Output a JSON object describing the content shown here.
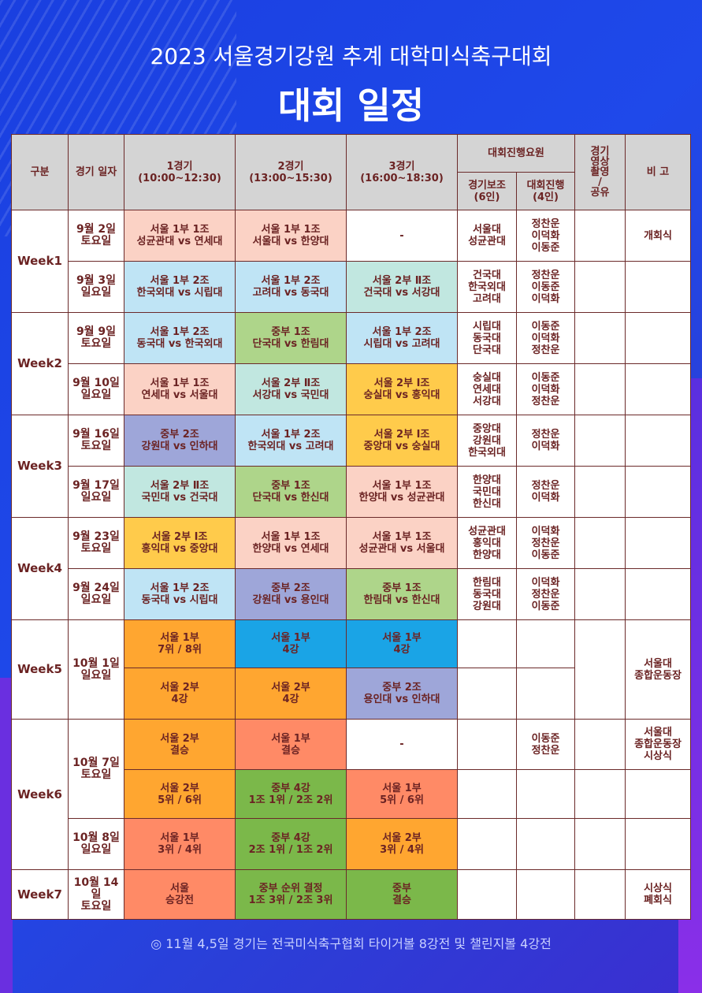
{
  "header": {
    "subtitle": "2023 서울경기강원 추계 대학미식축구대회",
    "title": "대회 일정"
  },
  "columns": {
    "category": "구분",
    "date": "경기 일자",
    "game1": "1경기\n(10:00~12:30)",
    "game2": "2경기\n(13:00~15:30)",
    "game3": "3경기\n(16:00~18:30)",
    "staff": "대회진행요원",
    "assist": "경기보조\n(6인)",
    "progress": "대회진행\n(4인)",
    "video": "경기\n영상\n촬영\n/\n공유",
    "note": "비 고"
  },
  "rows": [
    {
      "week": "Week1",
      "date": "9월 2일\n토요일",
      "g1": "서울 1부 1조\n성균관대 vs 연세대",
      "g2": "서울 1부 1조\n서울대 vs 한양대",
      "g3": "-",
      "assist": "서울대\n성균관대",
      "prog": "정찬운\n이덕화\n이동준",
      "video": "",
      "note": "개회식"
    },
    {
      "week": "",
      "date": "9월 3일\n일요일",
      "g1": "서울 1부 2조\n한국외대 vs 시립대",
      "g2": "서울 1부 2조\n고려대 vs 동국대",
      "g3": "서울 2부 Ⅱ조\n건국대 vs 서강대",
      "assist": "건국대\n한국외대\n고려대",
      "prog": "정찬운\n이동준\n이덕화",
      "video": "",
      "note": ""
    },
    {
      "week": "Week2",
      "date": "9월 9일\n토요일",
      "g1": "서울 1부 2조\n동국대 vs 한국외대",
      "g2": "중부 1조\n단국대 vs 한림대",
      "g3": "서울 1부 2조\n시립대 vs 고려대",
      "assist": "시립대\n동국대\n단국대",
      "prog": "이동준\n이덕화\n정찬운",
      "video": "",
      "note": ""
    },
    {
      "week": "",
      "date": "9월 10일\n일요일",
      "g1": "서울 1부 1조\n연세대 vs 서울대",
      "g2": "서울 2부 Ⅱ조\n서강대 vs 국민대",
      "g3": "서울 2부 Ⅰ조\n숭실대 vs 홍익대",
      "assist": "숭실대\n연세대\n서강대",
      "prog": "이동준\n이덕화\n정찬운",
      "video": "",
      "note": ""
    },
    {
      "week": "Week3",
      "date": "9월 16일\n토요일",
      "g1": "중부 2조\n강원대 vs 인하대",
      "g2": "서울 1부 2조\n한국외대 vs 고려대",
      "g3": "서울 2부 Ⅰ조\n중앙대 vs 숭실대",
      "assist": "중앙대\n강원대\n한국외대",
      "prog": "정찬운\n이덕화",
      "video": "",
      "note": ""
    },
    {
      "week": "",
      "date": "9월 17일\n일요일",
      "g1": "서울 2부 Ⅱ조\n국민대 vs 건국대",
      "g2": "중부 1조\n단국대 vs 한신대",
      "g3": "서울 1부 1조\n한양대 vs 성균관대",
      "assist": "한양대\n국민대\n한신대",
      "prog": "정찬운\n이덕화",
      "video": "",
      "note": ""
    },
    {
      "week": "Week4",
      "date": "9월 23일\n토요일",
      "g1": "서울 2부 Ⅰ조\n홍익대 vs 중앙대",
      "g2": "서울 1부 1조\n한양대 vs 연세대",
      "g3": "서울 1부 1조\n성균관대 vs 서울대",
      "assist": "성균관대\n홍익대\n한양대",
      "prog": "이덕화\n정찬운\n이동준",
      "video": "",
      "note": ""
    },
    {
      "week": "",
      "date": "9월 24일\n일요일",
      "g1": "서울 1부 2조\n동국대 vs 시립대",
      "g2": "중부 2조\n강원대 vs 용인대",
      "g3": "중부 1조\n한림대 vs 한신대",
      "assist": "한림대\n동국대\n강원대",
      "prog": "이덕화\n정찬운\n이동준",
      "video": "",
      "note": ""
    }
  ],
  "week5": {
    "week": "Week5",
    "date": "10월 1일\n일요일",
    "note": "서울대\n종합운동장",
    "r1": {
      "g1": "서울 1부\n7위 / 8위",
      "g2": "서울 1부\n4강",
      "g3": "서울 1부\n4강"
    },
    "r2": {
      "g1": "서울 2부\n4강",
      "g2": "서울 2부\n4강",
      "g3": "중부 2조\n용인대 vs 인하대"
    }
  },
  "week6": {
    "week": "Week6",
    "date1": "10월 7일\n토요일",
    "date2": "10월 8일\n일요일",
    "r1": {
      "g1": "서울 2부\n결승",
      "g2": "서울 1부\n결승",
      "g3": "-",
      "prog": "이동준\n정찬운",
      "note": "서울대\n종합운동장\n시상식"
    },
    "r2": {
      "g1": "서울 2부\n5위 / 6위",
      "g2": "중부 4강\n1조 1위 / 2조 2위",
      "g3": "서울 1부\n5위 / 6위"
    },
    "r3": {
      "g1": "서울 1부\n3위 / 4위",
      "g2": "중부 4강\n2조 1위 / 1조 2위",
      "g3": "서울 2부\n3위 / 4위"
    }
  },
  "week7": {
    "week": "Week7",
    "date": "10월 14\n일\n토요일",
    "g1": "서울\n승강전",
    "g2": "중부 순위 결정\n1조 3위 / 2조 3위",
    "g3": "중부\n결승",
    "note": "시상식\n폐회식"
  },
  "footer": "◎ 11월 4,5일 경기는 전국미식축구협회 타이거볼 8강전 및 챌린지볼 4강전",
  "colors": {
    "background": "#1f49ea",
    "pink": "#fbd2c5",
    "light_blue": "#bfe4f5",
    "mint": "#c1e7e0",
    "green": "#aed58a",
    "yellow": "#ffcb4b",
    "lavender": "#9ea6d9",
    "orange": "#ffa630",
    "sky": "#1aa4e6",
    "salmon": "#ff8a66",
    "dark_green": "#7bb84a",
    "text": "#6b2323"
  }
}
